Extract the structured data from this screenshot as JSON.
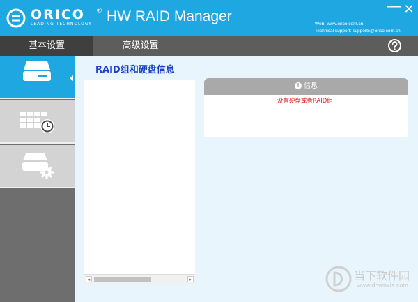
{
  "titlebar": {
    "logo_text": "ORICO",
    "logo_tagline": "LEADING TECHNOLOGY",
    "logo_reg": "®",
    "app_title": "HW RAID Manager",
    "minimize": "—",
    "close": "✕",
    "web": "Web: www.orico.com.cn",
    "support": "Technical support: supports@orico.com.cn",
    "color": "#1ea7e1"
  },
  "tabs": [
    {
      "label": "基本设置",
      "active": true
    },
    {
      "label": "高级设置",
      "active": false
    }
  ],
  "help_icon": "question-circle-icon",
  "sidebar": {
    "items": [
      {
        "icon": "hard-drive-icon",
        "active": true
      },
      {
        "icon": "table-clock-icon",
        "active": false
      },
      {
        "icon": "drive-settings-icon",
        "active": false
      }
    ]
  },
  "main": {
    "section_title": "RAID组和硬盘信息",
    "info": {
      "header": "信息",
      "message": "没有硬盘或者RAID组!"
    }
  },
  "watermark": {
    "text": "当下软件园",
    "url": "www.downxia.com"
  }
}
